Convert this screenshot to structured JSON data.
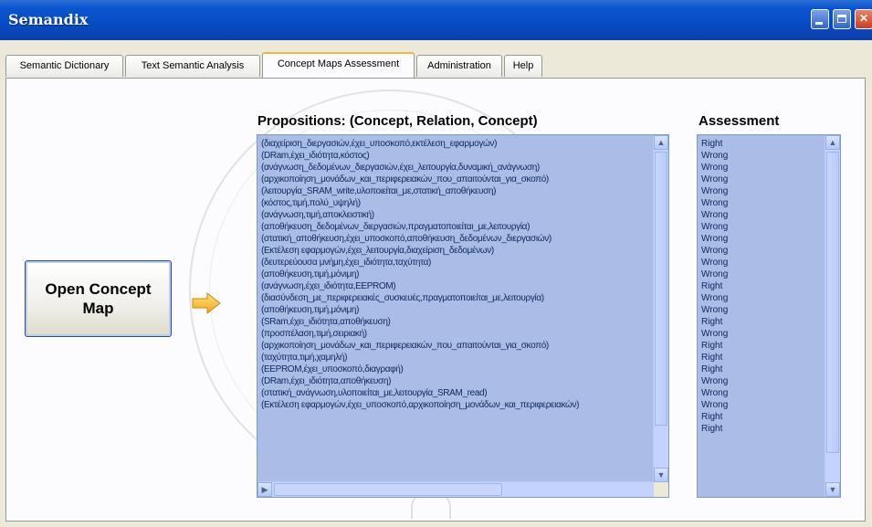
{
  "window": {
    "title": "Semandix"
  },
  "tabs": [
    {
      "label": "Semantic Dictionary"
    },
    {
      "label": "Text Semantic Analysis"
    },
    {
      "label": "Concept Maps Assessment"
    },
    {
      "label": "Administration"
    },
    {
      "label": "Help"
    }
  ],
  "active_tab": "Concept Maps Assessment",
  "open_button": {
    "label": "Open Concept Map"
  },
  "arrow_icon": "arrow-right-icon",
  "propositions": {
    "heading": "Propositions: (Concept, Relation, Concept)",
    "items": [
      "(διαχείριση_διεργασιών,έχει_υποσκοπό,εκτέλεση_εφαρμογών)",
      "(DRam,έχει_ιδιότητα,κόστος)",
      "(ανάγνωση_δεδομένων_διεργασιών,έχει_λειτουργία,δυναμική_ανάγνωση)",
      "(αρχικοποίηση_μονάδων_και_περιφερειακών_που_απαιτούνται_για_σκοπό)",
      "(λειτουργία_SRAM_write,υλοποιείται_με,στατική_αποθήκευση)",
      "(κόστος,τιμή,πολύ_υψηλή)",
      "(ανάγνωση,τιμή,αποκλειστική)",
      "(αποθήκευση_δεδομένων_διεργασιών,πραγματοποιείται_με,λειτουργία)",
      "(στατική_αποθήκευση,έχει_υποσκοπό,αποθήκευση_δεδομένων_διεργασιών)",
      "(Εκτέλεση εφαρμογών,έχει_λειτουργία,διαχείριση_δεδομένων)",
      "(δευτερεύουσα μνήμη,έχει_ιδιότητα,ταχύτητα)",
      "(αποθήκευση,τιμή,μόνιμη)",
      "(ανάγνωση,έχει_ιδιότητα,EEPROM)",
      "(διασύνδεση_με_περιφερειακές_συσκευές,πραγματοποιείται_με,λειτουργία)",
      "(αποθήκευση,τιμή,μόνιμη)",
      "(SRam,έχει_ιδιότητα,αποθήκευση)",
      "(προσπέλαση,τιμή,σειριακή)",
      "(αρχικοποίηση_μονάδων_και_περιφερειακών_που_απαιτούνται_για_σκοπό)",
      "(ταχύτητα,τιμή,χαμηλή)",
      "(EEPROM,έχει_υποσκοπό,διαγραφή)",
      "(DRam,έχει_ιδιότητα,αποθήκευση)",
      "(στατική_ανάγνωση,υλοποιείται_με,λειτουργία_SRAM_read)",
      "(Εκτέλεση εφαρμογών,έχει_υποσκοπό,αρχικοποίηση_μονάδων_και_περιφερειακών)"
    ]
  },
  "assessment": {
    "heading": "Assessment",
    "items": [
      "Right",
      "Wrong",
      "Wrong",
      "Wrong",
      "Wrong",
      "Wrong",
      "Wrong",
      "Wrong",
      "Wrong",
      "Wrong",
      "Wrong",
      "Wrong",
      "Right",
      "Wrong",
      "Wrong",
      "Right",
      "Wrong",
      "Right",
      "Right",
      "Right",
      "Wrong",
      "Wrong",
      "Wrong",
      "Right",
      "Right"
    ]
  }
}
